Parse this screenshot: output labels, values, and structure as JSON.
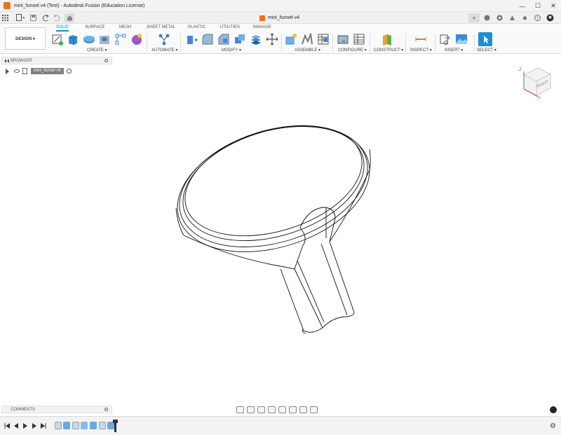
{
  "window": {
    "title": "mini_funnel v4 (Test) - Autodesk Fusion (Education License)",
    "controls": [
      "—",
      "☐",
      "✕"
    ]
  },
  "appbar": {
    "document_tab": "mini_funnel v4",
    "close_glyph": "×",
    "plus_glyph": "+"
  },
  "toolbar": {
    "workspace": "DESIGN ▾",
    "tabs": [
      "SOLID",
      "SURFACE",
      "MESH",
      "SHEET METAL",
      "PLASTIC",
      "UTILITIES",
      "MANAGE"
    ],
    "groups": [
      "CREATE ▾",
      "AUTOMATE ▾",
      "MODIFY ▾",
      "ASSEMBLE ▾",
      "CONFIGURE ▾",
      "CONSTRUCT ▾",
      "INSPECT ▾",
      "INSERT ▾",
      "SELECT ▾"
    ]
  },
  "browser": {
    "header": "BROWSER",
    "root_item": "mini_funnel v4"
  },
  "viewcube": {
    "face_label": "RIGHT",
    "axis_z": "Z",
    "axis_x": "X"
  },
  "comments": {
    "header": "COMMENTS"
  },
  "colors": {
    "accent": "#0696d7",
    "fusion_orange": "#e8731a",
    "select_blue": "#1b8fd2"
  }
}
